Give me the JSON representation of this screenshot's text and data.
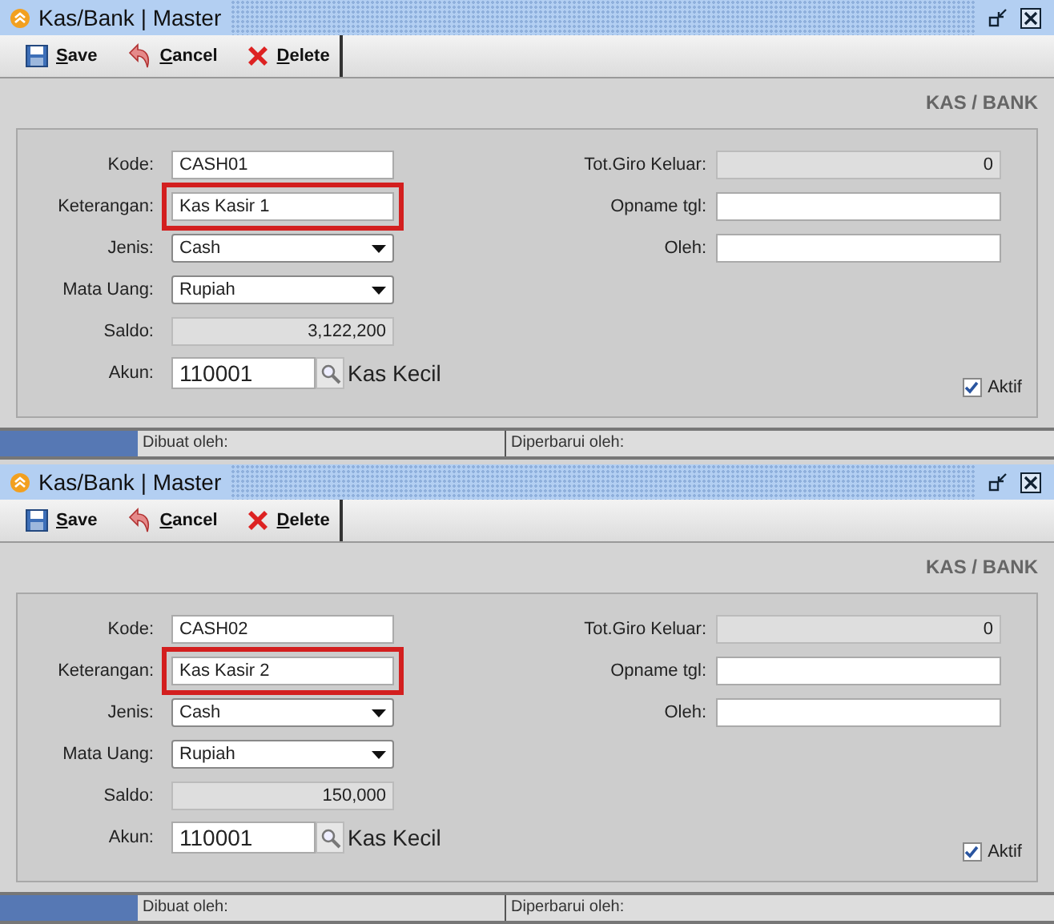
{
  "windows": [
    {
      "title": "Kas/Bank | Master",
      "toolbar": [
        {
          "kind": "save",
          "label": "Save"
        },
        {
          "kind": "cancel",
          "label": "Cancel"
        },
        {
          "kind": "delete",
          "label": "Delete"
        }
      ],
      "heading": "KAS / BANK",
      "left_fields": [
        {
          "label": "Kode:",
          "kind": "text",
          "value": "CASH01",
          "highlighted": false
        },
        {
          "label": "Keterangan:",
          "kind": "text",
          "value": "Kas Kasir 1",
          "highlighted": true
        },
        {
          "label": "Jenis:",
          "kind": "select",
          "value": "Cash",
          "highlighted": false
        },
        {
          "label": "Mata Uang:",
          "kind": "select",
          "value": "Rupiah",
          "highlighted": false
        },
        {
          "label": "Saldo:",
          "kind": "readonly",
          "value": "3,122,200",
          "highlighted": false
        },
        {
          "label": "Akun:",
          "kind": "lookup",
          "value": "110001",
          "description": "Kas Kecil",
          "highlighted": false
        }
      ],
      "right_fields": [
        {
          "label": "Tot.Giro Keluar:",
          "kind": "readonly",
          "value": "0"
        },
        {
          "label": "Opname tgl:",
          "kind": "text"
        },
        {
          "label": "Oleh:",
          "kind": "text"
        }
      ],
      "aktif": {
        "label": "Aktif",
        "checked": true
      },
      "status_bar": {
        "created_label": "Dibuat oleh:",
        "updated_label": "Diperbarui oleh:"
      }
    },
    {
      "title": "Kas/Bank | Master",
      "toolbar": [
        {
          "kind": "save",
          "label": "Save"
        },
        {
          "kind": "cancel",
          "label": "Cancel"
        },
        {
          "kind": "delete",
          "label": "Delete"
        }
      ],
      "heading": "KAS / BANK",
      "left_fields": [
        {
          "label": "Kode:",
          "kind": "text",
          "value": "CASH02",
          "highlighted": false
        },
        {
          "label": "Keterangan:",
          "kind": "text",
          "value": "Kas Kasir 2",
          "highlighted": true
        },
        {
          "label": "Jenis:",
          "kind": "select",
          "value": "Cash",
          "highlighted": false
        },
        {
          "label": "Mata Uang:",
          "kind": "select",
          "value": "Rupiah",
          "highlighted": false
        },
        {
          "label": "Saldo:",
          "kind": "readonly",
          "value": "150,000",
          "highlighted": false
        },
        {
          "label": "Akun:",
          "kind": "lookup",
          "value": "110001",
          "description": "Kas Kecil",
          "highlighted": false
        }
      ],
      "right_fields": [
        {
          "label": "Tot.Giro Keluar:",
          "kind": "readonly",
          "value": "0"
        },
        {
          "label": "Opname tgl:",
          "kind": "text"
        },
        {
          "label": "Oleh:",
          "kind": "text"
        }
      ],
      "aktif": {
        "label": "Aktif",
        "checked": true
      },
      "status_bar": {
        "created_label": "Dibuat oleh:",
        "updated_label": "Diperbarui oleh:"
      }
    }
  ]
}
